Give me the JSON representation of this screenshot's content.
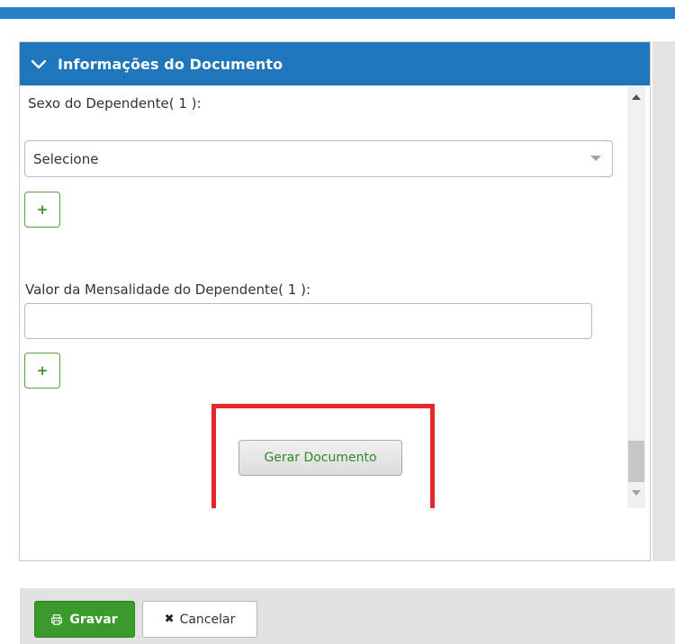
{
  "panel": {
    "title": "Informações do Documento"
  },
  "form": {
    "cut_label": "Sexo do Dependente( 1 ):",
    "select_value": "Selecione",
    "plus_label": "+",
    "dependent_fee_label": "Valor da Mensalidade do Dependente( 1 ):",
    "dependent_fee_value": "",
    "generate_label": "Gerar Documento"
  },
  "footer": {
    "save_label": "Gravar",
    "cancel_label": "Cancelar",
    "cancel_glyph": "✖"
  },
  "colors": {
    "header_blue": "#1f76bb",
    "save_green": "#3a9a2c",
    "highlight_red": "#e5282a"
  }
}
